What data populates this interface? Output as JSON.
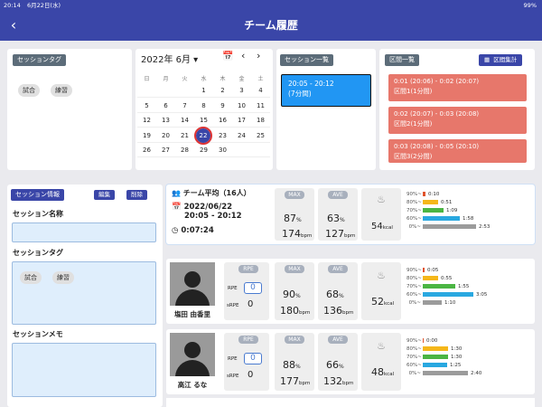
{
  "status": {
    "time": "20:14",
    "date": "6月22日(水)",
    "right": "99%"
  },
  "header": {
    "title": "チーム履歴",
    "back_icon": "chevron-left-icon"
  },
  "session_tag_panel": {
    "title": "セッションタグ",
    "tags": [
      "試合",
      "練習"
    ]
  },
  "calendar": {
    "month_label": "2022年 6月 ▾",
    "weekdays": [
      "日",
      "月",
      "火",
      "水",
      "木",
      "金",
      "土"
    ],
    "weeks": [
      [
        "",
        "",
        "",
        "1",
        "2",
        "3",
        "4"
      ],
      [
        "5",
        "6",
        "7",
        "8",
        "9",
        "10",
        "11"
      ],
      [
        "12",
        "13",
        "14",
        "15",
        "16",
        "17",
        "18"
      ],
      [
        "19",
        "20",
        "21",
        "22",
        "23",
        "24",
        "25"
      ],
      [
        "26",
        "27",
        "28",
        "29",
        "30",
        "",
        ""
      ]
    ],
    "selected": "22"
  },
  "session_list": {
    "title": "セッション一覧",
    "items": [
      {
        "time": "20:05 - 20:12",
        "duration": "(7分間)"
      }
    ]
  },
  "interval_list": {
    "title": "区間一覧",
    "summary_button": "区間集計",
    "items": [
      {
        "range": "0:01 (20:06) - 0:02 (20:07)",
        "label": "区間1(1分間)"
      },
      {
        "range": "0:02 (20:07) - 0:03 (20:08)",
        "label": "区間2(1分間)"
      },
      {
        "range": "0:03 (20:08) - 0:05 (20:10)",
        "label": "区間3(2分間)"
      }
    ]
  },
  "session_info": {
    "title": "セッション情報",
    "edit": "編集",
    "delete": "削除",
    "name_label": "セッション名称",
    "name_value": "",
    "tag_label": "セッションタグ",
    "tags": [
      "試合",
      "練習"
    ],
    "memo_label": "セッションメモ",
    "memo_value": ""
  },
  "team_summary": {
    "title": "チーム平均（16人）",
    "date": "2022/06/22",
    "time": "20:05 - 20:12",
    "duration": "0:07:24",
    "max_label": "MAX",
    "max_pct": "87",
    "max_bpm": "174",
    "ave_label": "AVE",
    "ave_pct": "63",
    "ave_bpm": "127",
    "kcal": "54",
    "zones": [
      {
        "label": "90%~",
        "value": "0:10",
        "frac": 0.04,
        "color": "#e0532b"
      },
      {
        "label": "80%~",
        "value": "0:51",
        "frac": 0.22,
        "color": "#f5b71a"
      },
      {
        "label": "70%~",
        "value": "1:09",
        "frac": 0.3,
        "color": "#4bb543"
      },
      {
        "label": "60%~",
        "value": "1:58",
        "frac": 0.52,
        "color": "#29a8e0"
      },
      {
        "label": "0%~",
        "value": "2:53",
        "frac": 0.76,
        "color": "#9b9b9b"
      }
    ]
  },
  "players": [
    {
      "name": "塩田 由香里",
      "rpe_label": "RPE",
      "rpe": "0",
      "srpe": "0",
      "max_pct": "90",
      "max_bpm": "180",
      "ave_pct": "68",
      "ave_bpm": "136",
      "kcal": "52",
      "zones": [
        {
          "label": "90%~",
          "value": "0:05",
          "frac": 0.02,
          "color": "#e0532b"
        },
        {
          "label": "80%~",
          "value": "0:55",
          "frac": 0.22,
          "color": "#f5b71a"
        },
        {
          "label": "70%~",
          "value": "1:55",
          "frac": 0.46,
          "color": "#4bb543"
        },
        {
          "label": "60%~",
          "value": "3:05",
          "frac": 0.72,
          "color": "#29a8e0"
        },
        {
          "label": "0%~",
          "value": "1:10",
          "frac": 0.27,
          "color": "#9b9b9b"
        }
      ]
    },
    {
      "name": "高江 るな",
      "rpe_label": "RPE",
      "rpe": "0",
      "srpe": "0",
      "max_pct": "88",
      "max_bpm": "177",
      "ave_pct": "66",
      "ave_bpm": "132",
      "kcal": "48",
      "zones": [
        {
          "label": "90%~",
          "value": "0:00",
          "frac": 0.0,
          "color": "#e0532b"
        },
        {
          "label": "80%~",
          "value": "1:30",
          "frac": 0.36,
          "color": "#f5b71a"
        },
        {
          "label": "70%~",
          "value": "1:30",
          "frac": 0.36,
          "color": "#4bb543"
        },
        {
          "label": "60%~",
          "value": "1:25",
          "frac": 0.34,
          "color": "#29a8e0"
        },
        {
          "label": "0%~",
          "value": "2:40",
          "frac": 0.64,
          "color": "#9b9b9b"
        }
      ]
    }
  ],
  "labels": {
    "pct": "%",
    "bpm": "bpm",
    "kcal": "kcal",
    "rpe": "RPE",
    "srpe": "sRPE",
    "max": "MAX",
    "ave": "AVE"
  }
}
